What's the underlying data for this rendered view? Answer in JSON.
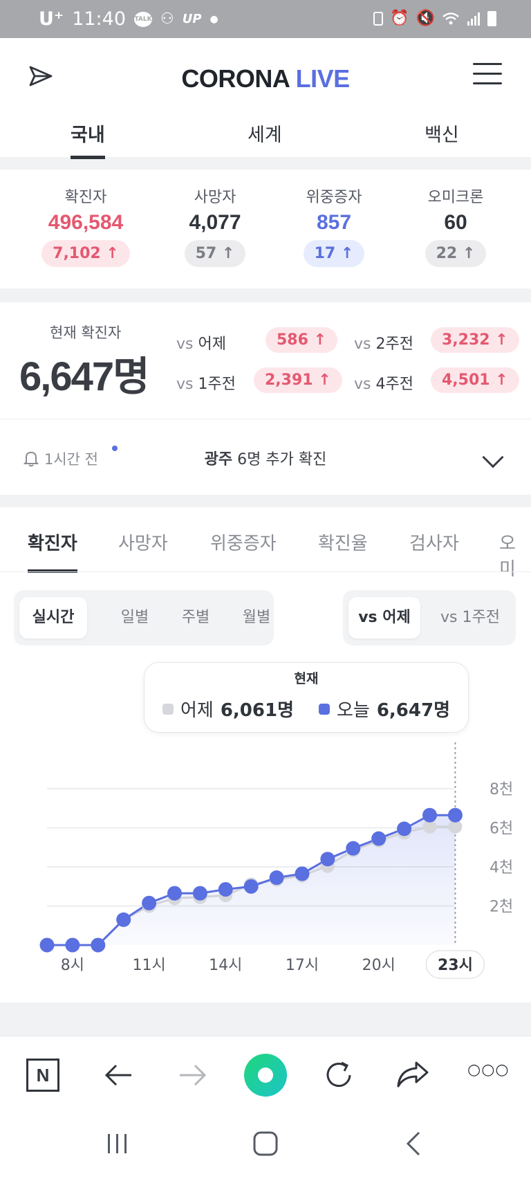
{
  "status_bar": {
    "carrier": "U⁺",
    "time": "11:40",
    "icons": [
      "talk-icon",
      "person-icon",
      "up-icon",
      "dot-icon",
      "battery-saver-icon",
      "alarm-icon",
      "mute-icon",
      "wifi-icon",
      "signal-icon",
      "battery-icon"
    ],
    "talk": "TALK",
    "up": "UP"
  },
  "header": {
    "logo_main": "CORONA",
    "logo_accent": "LIVE",
    "tabs": [
      {
        "label": "국내",
        "active": true
      },
      {
        "label": "세계",
        "active": false
      },
      {
        "label": "백신",
        "active": false
      }
    ]
  },
  "stats": [
    {
      "label": "확진자",
      "value": "496,584",
      "delta": "7,102",
      "color": "#e45870",
      "pill": "red"
    },
    {
      "label": "사망자",
      "value": "4,077",
      "delta": "57",
      "color": "#30343b",
      "pill": "gray"
    },
    {
      "label": "위중증자",
      "value": "857",
      "delta": "17",
      "color": "#5a6fe0",
      "pill": "blue"
    },
    {
      "label": "오미크론",
      "value": "60",
      "delta": "22",
      "color": "#30343b",
      "pill": "gray"
    }
  ],
  "up_arrow": "↑",
  "current": {
    "label": "현재 확진자",
    "value": "6,647명",
    "vs": "vs",
    "comparisons": [
      {
        "label": "어제",
        "delta": "586"
      },
      {
        "label": "2주전",
        "delta": "3,232"
      },
      {
        "label": "1주전",
        "delta": "2,391"
      },
      {
        "label": "4주전",
        "delta": "4,501"
      }
    ]
  },
  "alert": {
    "time": "1시간 전",
    "region": "광주",
    "message": "6명 추가 확진"
  },
  "chart_tabs": [
    {
      "label": "확진자",
      "active": true
    },
    {
      "label": "사망자",
      "active": false
    },
    {
      "label": "위중증자",
      "active": false
    },
    {
      "label": "확진율",
      "active": false
    },
    {
      "label": "검사자",
      "active": false
    },
    {
      "label": "오미",
      "active": false
    }
  ],
  "period_seg": [
    {
      "label": "실시간",
      "active": true
    },
    {
      "label": "일별",
      "active": false
    },
    {
      "label": "주별",
      "active": false
    },
    {
      "label": "월별",
      "active": false
    }
  ],
  "compare_seg": [
    {
      "label": "vs 어제",
      "active": true
    },
    {
      "label": "vs 1주전",
      "active": false
    }
  ],
  "tooltip": {
    "header": "현재",
    "yesterday_label": "어제",
    "yesterday_value": "6,061명",
    "today_label": "오늘",
    "today_value": "6,647명"
  },
  "chart_data": {
    "type": "line",
    "x": [
      "7시",
      "8시",
      "9시",
      "10시",
      "11시",
      "12시",
      "13시",
      "14시",
      "15시",
      "16시",
      "17시",
      "18시",
      "19시",
      "20시",
      "21시",
      "22시",
      "23시"
    ],
    "x_tick_labels": [
      "8시",
      "11시",
      "14시",
      "17시",
      "20시",
      "23시"
    ],
    "y_tick_labels": [
      "2천",
      "4천",
      "6천",
      "8천"
    ],
    "ylim": [
      0,
      8000
    ],
    "grid": true,
    "series": [
      {
        "name": "어제",
        "color": "#d6d7db",
        "values": [
          0,
          0,
          0,
          1300,
          2000,
          2400,
          2450,
          2550,
          3100,
          3350,
          3550,
          4050,
          4850,
          5350,
          5750,
          6061,
          6061
        ]
      },
      {
        "name": "오늘",
        "color": "#5a6fe0",
        "values": [
          0,
          0,
          0,
          1300,
          2150,
          2650,
          2650,
          2850,
          3000,
          3450,
          3650,
          4400,
          4950,
          5450,
          5950,
          6647,
          6647
        ]
      }
    ]
  },
  "browser_bar": {
    "icons": [
      "naver-icon",
      "back-arrow-icon",
      "forward-arrow-icon",
      "green-dot-icon",
      "refresh-icon",
      "share-icon",
      "more-icon"
    ],
    "naver": "N",
    "more": "○○○"
  },
  "nav_bar": {
    "icons": [
      "recents-icon",
      "home-icon",
      "back-icon"
    ]
  }
}
